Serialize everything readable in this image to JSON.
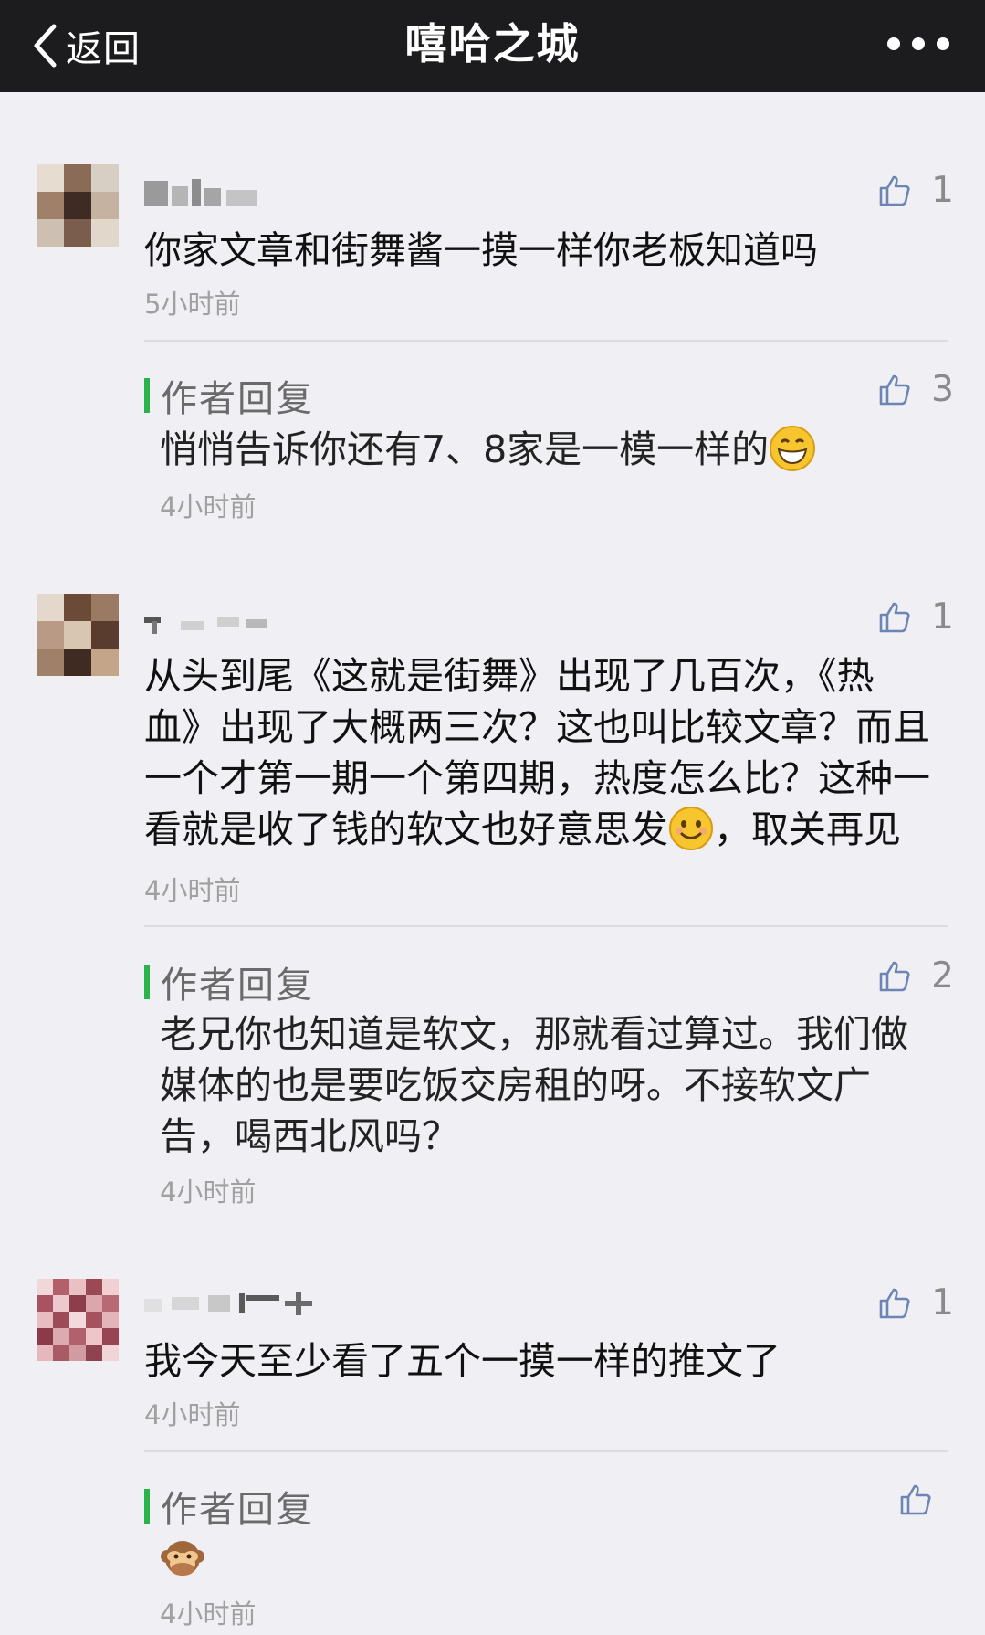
{
  "navbar": {
    "back_label": "返回",
    "title": "嘻哈之城",
    "more_icon": "more-dots-icon"
  },
  "comments": [
    {
      "text": "你家文章和街舞酱一摸一样你老板知道吗",
      "time": "5小时前",
      "likes": "1",
      "reply": {
        "label": "作者回复",
        "text": "悄悄告诉你还有7、8家是一模一样的",
        "emoji": "grinning-face-emoji",
        "time": "4小时前",
        "likes": "3"
      }
    },
    {
      "text_lines": [
        "从头到尾《这就是街舞》出现了几百次，《热",
        "血》出现了大概两三次？这也叫比较文章？而且",
        "一个才第一期一个第四期，热度怎么比？这种一",
        "看就是收了钱的软文也好意思发"
      ],
      "text_tail": "，取关再见",
      "emoji": "smiling-face-emoji",
      "time": "4小时前",
      "likes": "1",
      "reply": {
        "label": "作者回复",
        "text_lines": [
          "老兄你也知道是软文，那就看过算过。我们做",
          "媒体的也是要吃饭交房租的呀。不接软文广",
          "告，喝西北风吗？"
        ],
        "time": "4小时前",
        "likes": "2"
      }
    },
    {
      "text": "我今天至少看了五个一摸一样的推文了",
      "time": "4小时前",
      "likes": "1",
      "reply": {
        "label": "作者回复",
        "emoji": "see-no-evil-monkey-emoji",
        "time": "4小时前"
      }
    }
  ],
  "colors": {
    "navbar_bg": "#1c1c1e",
    "page_bg": "#efeff4",
    "reply_bar": "#2ab24b",
    "muted_text": "#a0a0a0"
  }
}
